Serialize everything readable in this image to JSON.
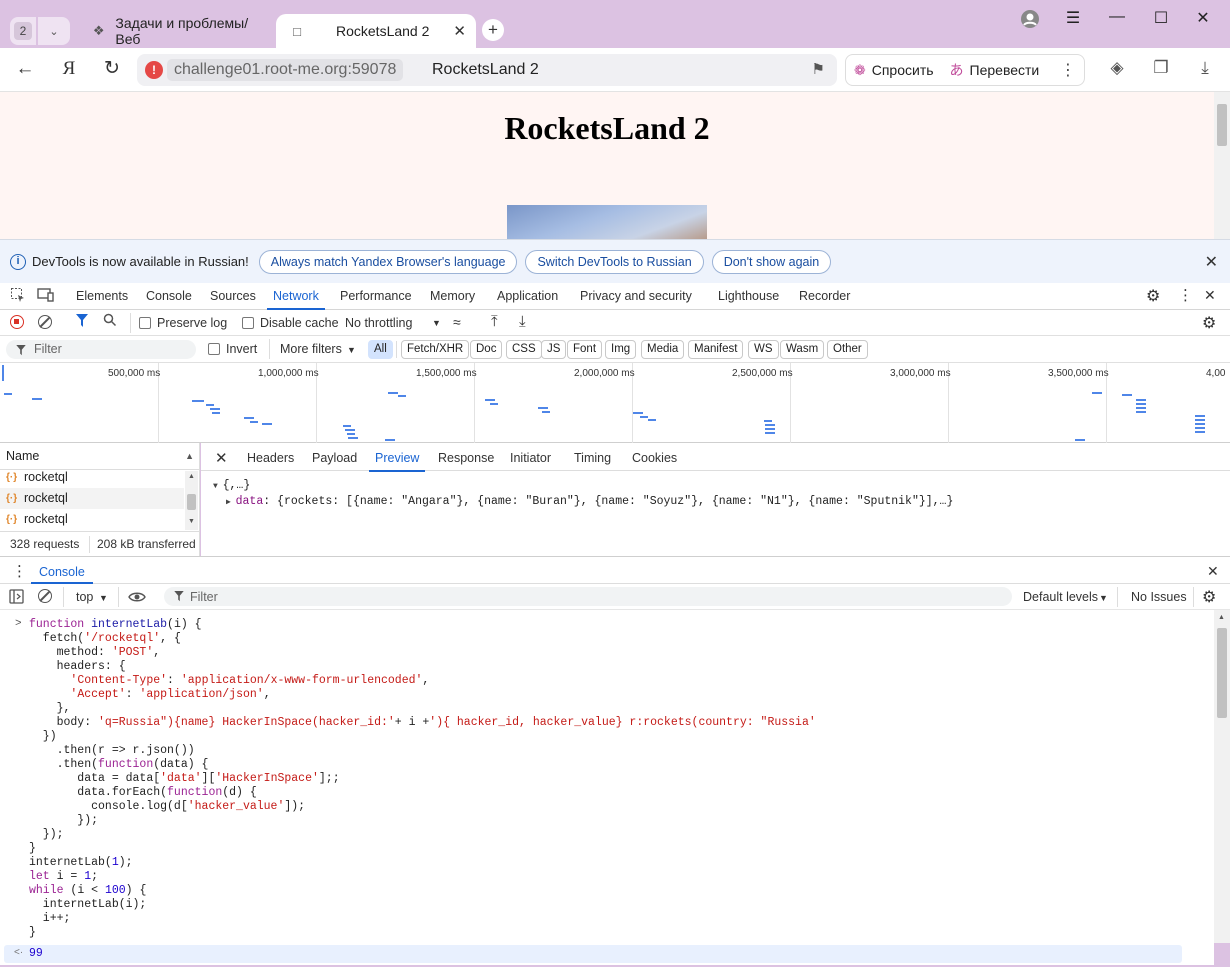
{
  "browser": {
    "tab_count": "2",
    "tabs": [
      {
        "title": "Задачи и проблемы/Веб"
      },
      {
        "title": "RocketsLand 2"
      }
    ],
    "url_host": "challenge01.root-me.org:59078",
    "url_title": "RocketsLand 2",
    "ask_label": "Спросить",
    "translate_label": "Перевести"
  },
  "page": {
    "heading": "RocketsLand 2"
  },
  "infobar": {
    "text": "DevTools is now available in Russian!",
    "btn_match": "Always match Yandex Browser's language",
    "btn_switch": "Switch DevTools to Russian",
    "btn_dont": "Don't show again"
  },
  "devtools": {
    "tabs": [
      "Elements",
      "Console",
      "Sources",
      "Network",
      "Performance",
      "Memory",
      "Application",
      "Privacy and security",
      "Lighthouse",
      "Recorder"
    ],
    "network_toolbar": {
      "preserve_log": "Preserve log",
      "disable_cache": "Disable cache",
      "throttling": "No throttling"
    },
    "filter_bar": {
      "placeholder": "Filter",
      "invert": "Invert",
      "more_filters": "More filters",
      "chips": [
        "All",
        "Fetch/XHR",
        "Doc",
        "CSS",
        "JS",
        "Font",
        "Img",
        "Media",
        "Manifest",
        "WS",
        "Wasm",
        "Other"
      ]
    },
    "overview_labels": [
      "500,000 ms",
      "1,000,000 ms",
      "1,500,000 ms",
      "2,000,000 ms",
      "2,500,000 ms",
      "3,000,000 ms",
      "3,500,000 ms",
      "4,00"
    ],
    "request_list": {
      "header": "Name",
      "rows": [
        "rocketql",
        "rocketql",
        "rocketql"
      ],
      "requests": "328 requests",
      "transferred": "208 kB transferred"
    },
    "detail_tabs": [
      "Headers",
      "Payload",
      "Preview",
      "Response",
      "Initiator",
      "Timing",
      "Cookies"
    ],
    "preview": {
      "root": "{,…}",
      "data_key": "data",
      "data_value": "{rockets: [{name: \"Angara\"}, {name: \"Buran\"}, {name: \"Soyuz\"}, {name: \"N1\"}, {name: \"Sputnik\"}],…}"
    },
    "console": {
      "tab": "Console",
      "context": "top",
      "filter_placeholder": "Filter",
      "levels": "Default levels",
      "issues": "No Issues",
      "result": "99"
    }
  },
  "colors": {
    "titlebar": "#dcc2e2",
    "accent": "#1a64d2",
    "page_bg": "#fff5f3"
  }
}
